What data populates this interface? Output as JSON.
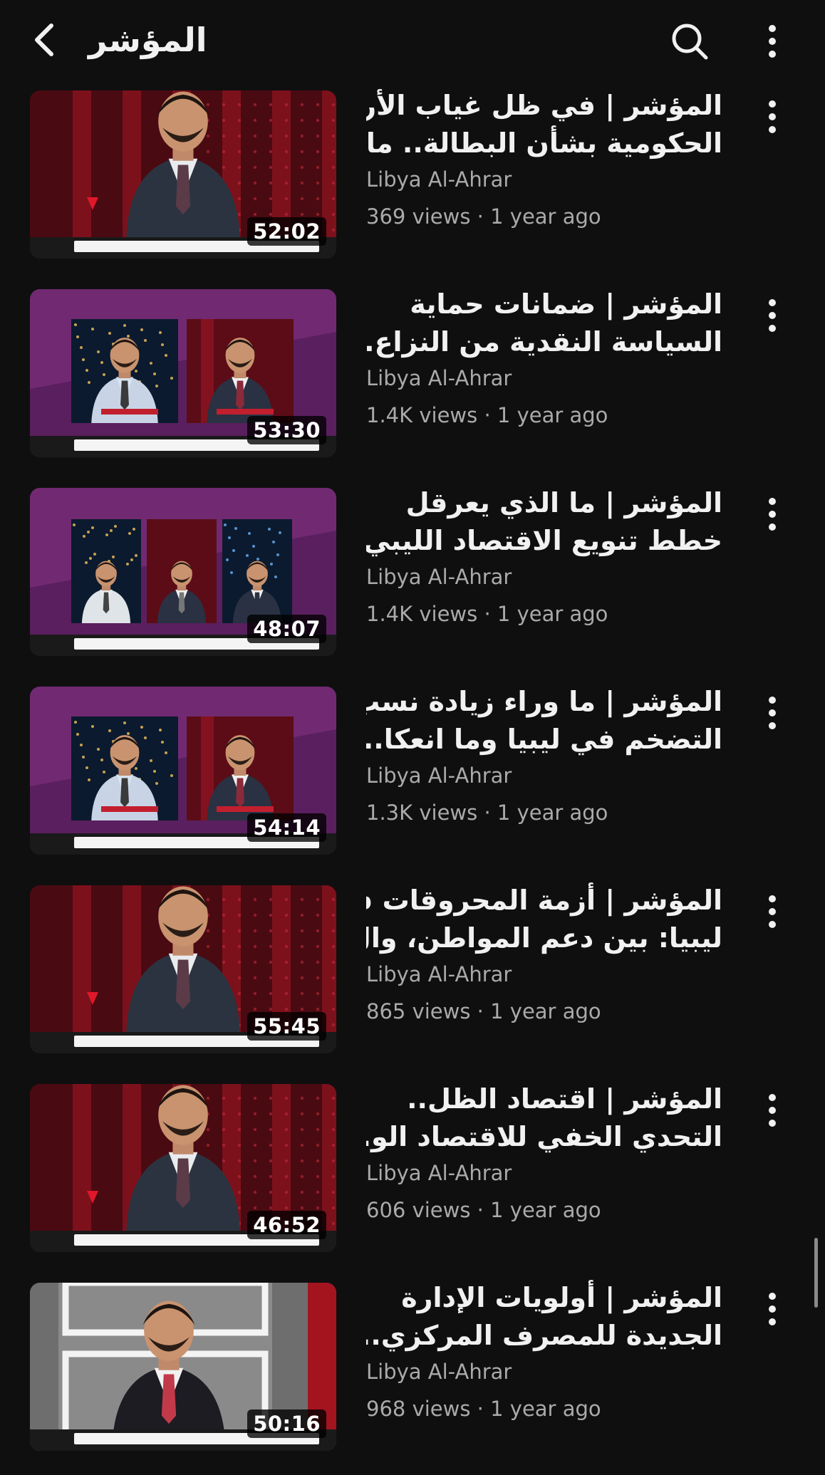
{
  "header": {
    "title": "المؤشر",
    "icons": {
      "back": "chevron-left-icon",
      "search": "search-icon",
      "more": "more-vertical-icon"
    }
  },
  "videos": [
    {
      "title_line1": "المؤشر | في ظل غياب الأرقام",
      "title_line2": "الحكومية بشأن البطالة.. ما...",
      "channel": "Libya Al-Ahrar",
      "meta": "369 views · 1 year ago",
      "duration": "52:02",
      "thumb_style": "single-host"
    },
    {
      "title_line1": "المؤشر | ضمانات حماية",
      "title_line2": "السياسة النقدية من النزاع...",
      "channel": "Libya Al-Ahrar",
      "meta": "1.4K views · 1 year ago",
      "duration": "53:30",
      "thumb_style": "split-two"
    },
    {
      "title_line1": "المؤشر | ما الذي يعرقل",
      "title_line2": "خطط تنويع الاقتصاد الليبي...",
      "channel": "Libya Al-Ahrar",
      "meta": "1.4K views · 1 year ago",
      "duration": "48:07",
      "thumb_style": "split-three"
    },
    {
      "title_line1": "المؤشر | ما وراء زيادة نسب",
      "title_line2": "التضخم في ليبيا وما انعكا...",
      "channel": "Libya Al-Ahrar",
      "meta": "1.3K views · 1 year ago",
      "duration": "54:14",
      "thumb_style": "split-two"
    },
    {
      "title_line1": "المؤشر | أزمة المحروقات في",
      "title_line2": "ليبيا: بين دعم المواطن، وال...",
      "channel": "Libya Al-Ahrar",
      "meta": "865 views · 1 year ago",
      "duration": "55:45",
      "thumb_style": "single-host"
    },
    {
      "title_line1": "المؤشر | اقتصاد الظل..",
      "title_line2": "التحدي الخفي للاقتصاد الو...",
      "channel": "Libya Al-Ahrar",
      "meta": "606 views · 1 year ago",
      "duration": "46:52",
      "thumb_style": "single-host"
    },
    {
      "title_line1": "المؤشر | أولويات الإدارة",
      "title_line2": "الجديدة للمصرف المركزي...",
      "channel": "Libya Al-Ahrar",
      "meta": "968 views · 1 year ago",
      "duration": "50:16",
      "thumb_style": "studio-frame"
    }
  ],
  "colors": {
    "background": "#0f0f0f",
    "text_primary": "#f1f1f1",
    "text_secondary": "#aaaaaa",
    "progress_red": "#ff0033"
  }
}
